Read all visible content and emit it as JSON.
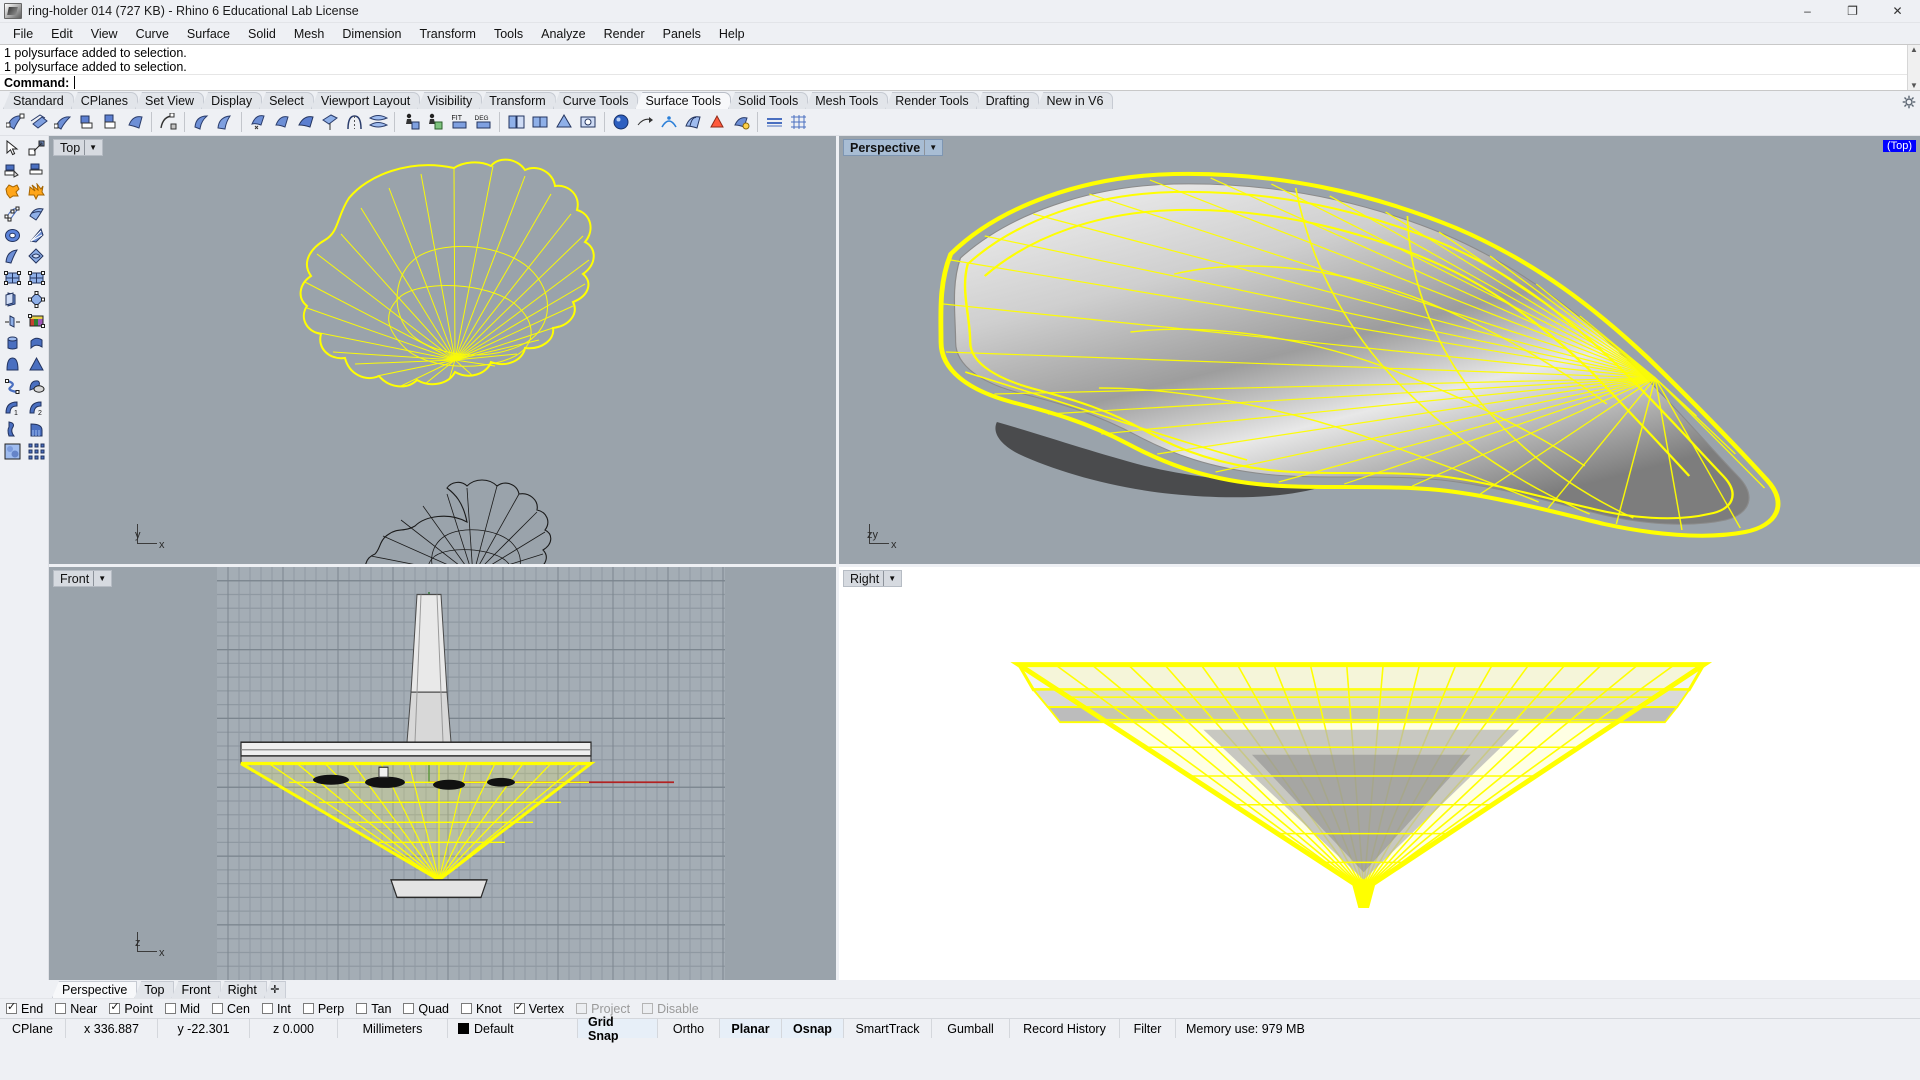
{
  "window": {
    "title": "ring-holder 014 (727 KB) - Rhino 6 Educational Lab License",
    "app_icon": "rhino-icon",
    "minimize": "–",
    "maximize": "❐",
    "close": "✕"
  },
  "menu": [
    "File",
    "Edit",
    "View",
    "Curve",
    "Surface",
    "Solid",
    "Mesh",
    "Dimension",
    "Transform",
    "Tools",
    "Analyze",
    "Render",
    "Panels",
    "Help"
  ],
  "command": {
    "history": [
      "1 polysurface added to selection.",
      "1 polysurface added to selection."
    ],
    "prompt_label": "Command:",
    "prompt_value": ""
  },
  "toolbar_tabs": {
    "active": "Surface Tools",
    "items": [
      "Standard",
      "CPlanes",
      "Set View",
      "Display",
      "Select",
      "Viewport Layout",
      "Visibility",
      "Transform",
      "Curve Tools",
      "Surface Tools",
      "Solid Tools",
      "Mesh Tools",
      "Render Tools",
      "Drafting",
      "New in V6"
    ]
  },
  "icon_toolbar": [
    "surface-from-curves-icon",
    "surface-from-points-icon",
    "surface-loft-icon",
    "surface-revolve-icon",
    "surface-rail-revolve-icon",
    "surface-sweep1-icon",
    "surface-network-icon",
    "surface-patch-icon",
    "surface-drape-icon",
    "surface-extrude-straight-icon",
    "surface-extrude-tapered-icon",
    "surface-extrude-ribbon-icon",
    "surface-offset-icon",
    "surface-blend-icon",
    "surface-fillet-icon",
    "surface-fit-icon",
    "surface-rebuild-icon",
    "fit-surface-icon",
    "deg-surface-icon",
    "surface-match-icon",
    "surface-merge-icon",
    "surface-untrim-icon",
    "surface-split-icon",
    "surface-unroll-icon",
    "surface-cap-icon",
    "surface-shading-icon",
    "surface-texture-icon",
    "surface-curvature-icon",
    "surface-direction-icon",
    "surface-isocurve-icon",
    "surface-draft-icon",
    "surface-edit-icon"
  ],
  "left_toolbar": [
    "select-object-icon",
    "select-by-rectangle-icon",
    "extrude-surface-icon",
    "extrude-curve-icon",
    "boolean-union-icon",
    "boolean-split-icon",
    "control-points-on-icon",
    "rebuild-surface-icon",
    "torus-icon",
    "sweep-fan-icon",
    "curved-surface-icon",
    "patch-surface-icon",
    "surface-grid-icon",
    "surface-grid-points-icon",
    "extrude-planar-icon",
    "rotate-points-icon",
    "mirror-icon",
    "render-color-icon",
    "cylinder-icon",
    "pipe-icon",
    "dome-icon",
    "cone-icon",
    "curve-blend-icon",
    "ellipsoid-icon",
    "fillet-1-icon",
    "fillet-2-icon",
    "taper-icon",
    "flow-along-surface-icon",
    "blur-texture-icon",
    "array-grid-icon"
  ],
  "viewports": [
    {
      "name": "Top",
      "title": "Top",
      "active": false,
      "style": "shaded-gray",
      "axis_labels": [
        "y",
        "x"
      ],
      "badge": null
    },
    {
      "name": "Perspective",
      "title": "Perspective",
      "active": true,
      "style": "shaded-gray",
      "axis_labels": [
        "zy",
        "x"
      ],
      "badge": "(Top)"
    },
    {
      "name": "Front",
      "title": "Front",
      "active": false,
      "style": "grid-gray",
      "axis_labels": [
        "z",
        "x"
      ],
      "badge": null
    },
    {
      "name": "Right",
      "title": "Right",
      "active": false,
      "style": "white",
      "axis_labels": [],
      "badge": null
    }
  ],
  "viewport_dropdown_glyph": "▼",
  "viewport_tabs": {
    "active": "Perspective",
    "items": [
      "Perspective",
      "Top",
      "Front",
      "Right"
    ],
    "add_label": "✛"
  },
  "osnap": [
    {
      "label": "End",
      "checked": true,
      "enabled": true
    },
    {
      "label": "Near",
      "checked": false,
      "enabled": true
    },
    {
      "label": "Point",
      "checked": true,
      "enabled": true
    },
    {
      "label": "Mid",
      "checked": false,
      "enabled": true
    },
    {
      "label": "Cen",
      "checked": false,
      "enabled": true
    },
    {
      "label": "Int",
      "checked": false,
      "enabled": true
    },
    {
      "label": "Perp",
      "checked": false,
      "enabled": true
    },
    {
      "label": "Tan",
      "checked": false,
      "enabled": true
    },
    {
      "label": "Quad",
      "checked": false,
      "enabled": true
    },
    {
      "label": "Knot",
      "checked": false,
      "enabled": true
    },
    {
      "label": "Vertex",
      "checked": true,
      "enabled": true
    },
    {
      "label": "Project",
      "checked": false,
      "enabled": false
    },
    {
      "label": "Disable",
      "checked": false,
      "enabled": false
    }
  ],
  "statusbar": {
    "cplane": "CPlane",
    "x": "x 336.887",
    "y": "y -22.301",
    "z": "z 0.000",
    "units": "Millimeters",
    "layer": "Default",
    "layer_color": "#000000",
    "toggles": [
      {
        "label": "Grid Snap",
        "on": true
      },
      {
        "label": "Ortho",
        "on": false
      },
      {
        "label": "Planar",
        "on": true
      },
      {
        "label": "Osnap",
        "on": true
      },
      {
        "label": "SmartTrack",
        "on": false
      },
      {
        "label": "Gumball",
        "on": false
      },
      {
        "label": "Record History",
        "on": false
      },
      {
        "label": "Filter",
        "on": false
      }
    ],
    "memory": "Memory use: 979 MB"
  },
  "colors": {
    "selection_yellow": "#ffff00",
    "viewport_bg": "#9aa3ab",
    "chrome": "#eef0f4",
    "active_title": "#a8bdd4",
    "badge_blue": "#0000ff"
  }
}
